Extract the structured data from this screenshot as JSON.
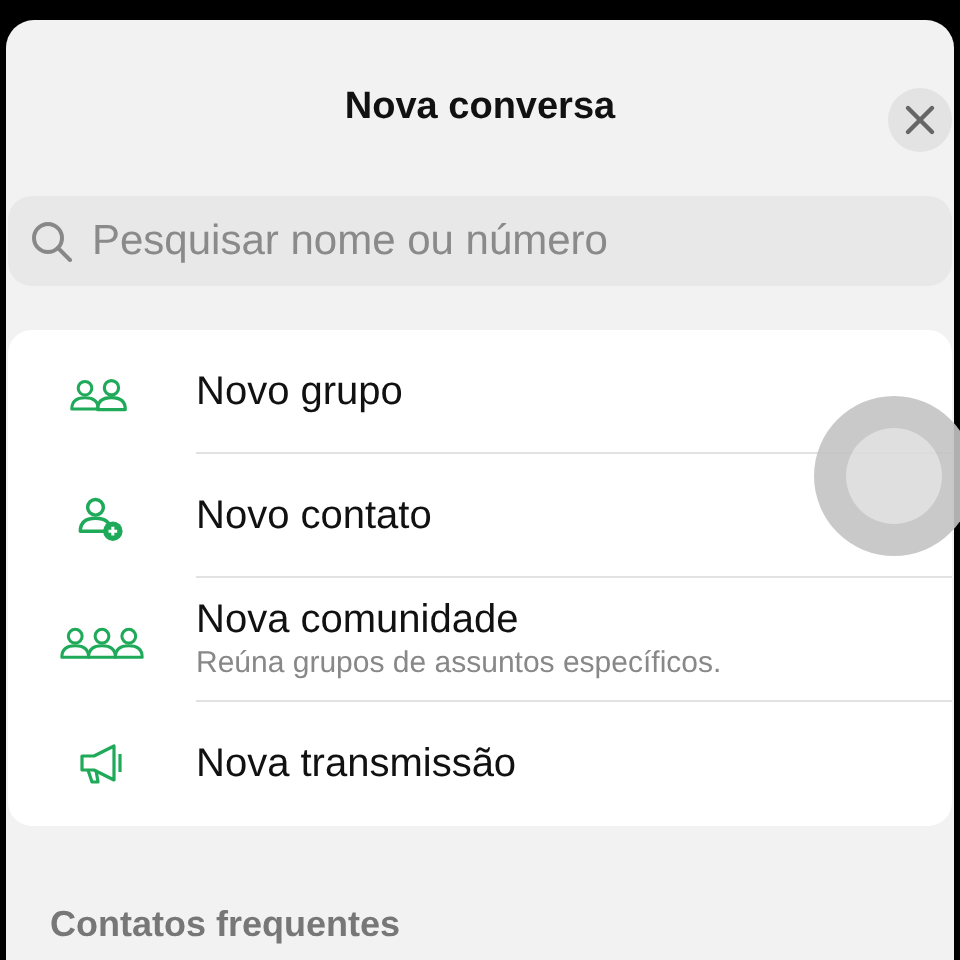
{
  "header": {
    "title": "Nova conversa"
  },
  "search": {
    "placeholder": "Pesquisar nome ou número"
  },
  "actions": [
    {
      "label": "Novo grupo"
    },
    {
      "label": "Novo contato"
    },
    {
      "label": "Nova comunidade",
      "subtitle": "Reúna grupos de assuntos específicos."
    },
    {
      "label": "Nova transmissão"
    }
  ],
  "section": {
    "title": "Contatos frequentes"
  }
}
